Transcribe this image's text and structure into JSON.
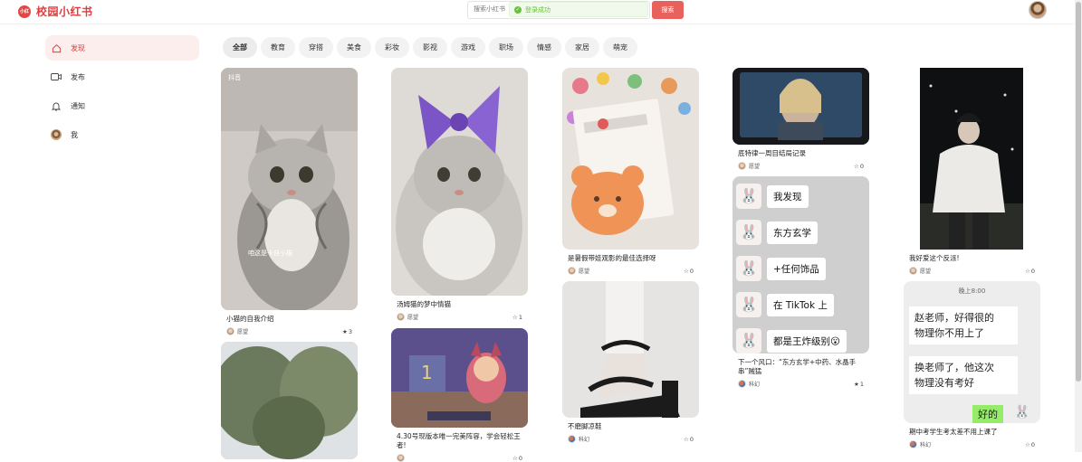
{
  "header": {
    "logo_mark": "小红书",
    "brand": "校园小红书",
    "search_placeholder": "搜索小红书",
    "toast": "登录成功",
    "search_button": "搜索"
  },
  "sidebar": {
    "items": [
      {
        "label": "发现",
        "icon": "home-icon"
      },
      {
        "label": "发布",
        "icon": "video-icon"
      },
      {
        "label": "通知",
        "icon": "bell-icon"
      },
      {
        "label": "我",
        "icon": "avatar"
      }
    ]
  },
  "tabs": [
    "全部",
    "教育",
    "穿搭",
    "美食",
    "彩妆",
    "影视",
    "游戏",
    "职场",
    "情感",
    "家居",
    "萌宠"
  ],
  "cards": [
    {
      "title": "小猫的自我介绍",
      "author": "愿望",
      "likes": "3",
      "liked": true,
      "overlay_text": "咱这是卡自小猫",
      "watermark": "抖音"
    },
    {
      "title": "汤姆猫的梦中情猫",
      "author": "愿望",
      "likes": "1"
    },
    {
      "title": "4.30号现版本唯一完美阵容，学会轻松王者!",
      "author": "",
      "likes": "0"
    },
    {
      "title": "是暑假带娃观影的最佳选择呀",
      "author": "愿望",
      "likes": "0"
    },
    {
      "title": "不磨脚凉鞋",
      "author": "科幻",
      "likes": "0"
    },
    {
      "title": "底特律一周目结局记录",
      "author": "愿望",
      "likes": "0"
    },
    {
      "title": "下一个风口：“东方玄学+中药、水晶手串”贼猛",
      "author": "科幻",
      "likes": "1",
      "liked": true,
      "bubbles": [
        "我发现",
        "东方玄学",
        "+任何饰品",
        "在 TikTok 上",
        "都是王炸级别😮"
      ]
    },
    {
      "title": "我好爱这个反派!",
      "author": "愿望",
      "likes": "0"
    },
    {
      "title": "期中考学生考太差不用上课了",
      "author": "科幻",
      "likes": "0",
      "chat_time": "晚上8:00",
      "chat": [
        "赵老师，好得很的",
        "物理你不用上了",
        "换老师了，他这次",
        "物理没有考好",
        "好的"
      ]
    }
  ],
  "colors": {
    "accent": "#e23b3b",
    "toast_green": "#67c23a"
  }
}
